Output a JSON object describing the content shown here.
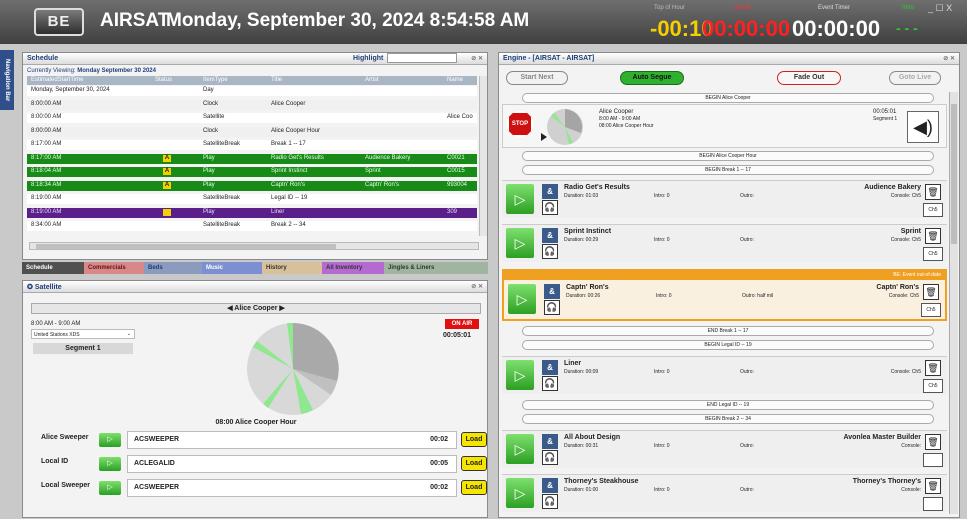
{
  "header": {
    "logo": "BE",
    "station": "AIRSAT",
    "datetime": "Monday, September 30, 2024 8:54:58 AM",
    "top_of_hour_label": "Top of Hour",
    "top_of_hour": "-00:10",
    "break_label": "Break",
    "break_value": "00:00:00",
    "event_timer_label": "Event Timer",
    "event_timer": "00:00:00",
    "intro_label": "Intro",
    "intro_value": "- - -",
    "window_controls": "_ ☐ X",
    "accent": "#f5d000",
    "break_color": "#ff2020"
  },
  "nav": {
    "label": "Navigation Bar"
  },
  "schedule": {
    "title": "Schedule",
    "highlight_label": "Highlight",
    "viewing_label": "Currently Viewing:",
    "viewing_date": "Monday September 30 2024",
    "columns": [
      "EstimatedStartTime",
      "Status",
      "ItemType",
      "Title",
      "Artist",
      "Name"
    ],
    "rows": [
      {
        "time": "Monday, September 30, 2024",
        "status": "",
        "type": "Day",
        "title": "",
        "artist": "",
        "name": "",
        "bg": "#ffffff",
        "fg": "#222",
        "badge": ""
      },
      {
        "time": "8:00:00 AM",
        "status": "",
        "type": "Clock",
        "title": "Alice Cooper",
        "artist": "",
        "name": "",
        "bg": "#f0f0f0",
        "fg": "#222",
        "badge": ""
      },
      {
        "time": "8:00:00 AM",
        "status": "",
        "type": "Satellite",
        "title": "",
        "artist": "",
        "name": "Alice Coo",
        "bg": "#ffffff",
        "fg": "#222",
        "badge": ""
      },
      {
        "time": "8:00:00 AM",
        "status": "",
        "type": "Clock",
        "title": "Alice Cooper Hour",
        "artist": "",
        "name": "",
        "bg": "#f0f0f0",
        "fg": "#222",
        "badge": ""
      },
      {
        "time": "8:17:00 AM",
        "status": "",
        "type": "SatelliteBreak",
        "title": "Break 1 -- 17",
        "artist": "",
        "name": "",
        "bg": "#ffffff",
        "fg": "#222",
        "badge": ""
      },
      {
        "time": "8:17:00 AM",
        "status": "A",
        "type": "Play",
        "title": "Radio Get's Results",
        "artist": "Audience Bakery",
        "name": "C0021",
        "bg": "#178a17",
        "fg": "#e8ffe8",
        "badge": "A"
      },
      {
        "time": "8:18:04 AM",
        "status": "A",
        "type": "Play",
        "title": "Sprint Instinct",
        "artist": "Sprint",
        "name": "C0015",
        "bg": "#178a17",
        "fg": "#e8ffe8",
        "badge": "A"
      },
      {
        "time": "8:18:34 AM",
        "status": "A",
        "type": "Play",
        "title": "Captn' Ron's",
        "artist": "Captn' Ron's",
        "name": "993004",
        "bg": "#178a17",
        "fg": "#e8ffe8",
        "badge": "A"
      },
      {
        "time": "8:19:00 AM",
        "status": "",
        "type": "SatelliteBreak",
        "title": "Legal ID -- 19",
        "artist": "",
        "name": "",
        "bg": "#ffffff",
        "fg": "#222",
        "badge": ""
      },
      {
        "time": "8:19:00 AM",
        "status": "",
        "type": "Play",
        "title": "Liner",
        "artist": "",
        "name": "309",
        "bg": "#5a1f8a",
        "fg": "#e8e0f5",
        "badge": "Y"
      },
      {
        "time": "8:34:00 AM",
        "status": "",
        "type": "SatelliteBreak",
        "title": "Break 2 -- 34",
        "artist": "",
        "name": "",
        "bg": "#ffffff",
        "fg": "#222",
        "badge": ""
      }
    ]
  },
  "tabs": [
    {
      "label": "Schedule",
      "bg": "#505050",
      "fg": "#ffffff"
    },
    {
      "label": "Commercials",
      "bg": "#d88888",
      "fg": "#6a1010"
    },
    {
      "label": "Beds",
      "bg": "#8b9bbd",
      "fg": "#1d3f7a"
    },
    {
      "label": "Music",
      "bg": "#7b8fd1",
      "fg": "#ffffff"
    },
    {
      "label": "History",
      "bg": "#d8c09a",
      "fg": "#333"
    },
    {
      "label": "All Inventory",
      "bg": "#b56ad1",
      "fg": "#333"
    },
    {
      "label": "Jingles & Liners",
      "bg": "#9fb59f",
      "fg": "#333"
    }
  ],
  "satellite": {
    "title": "Satellite",
    "now_playing": "Alice Cooper",
    "time_range": "8:00 AM - 9:00 AM",
    "station_select": "United Stations XDS",
    "segment": "Segment 1",
    "status": "ON AIR",
    "elapsed": "00:05:01",
    "hour_name": "08:00 Alice Cooper Hour",
    "slots": [
      {
        "name": "Alice Sweeper",
        "value": "ACSWEEPER",
        "time": "00:02",
        "load": "Load"
      },
      {
        "name": "Local ID",
        "value": "ACLEGALID",
        "time": "00:05",
        "load": "Load"
      },
      {
        "name": "Local Sweeper",
        "value": "ACSWEEPER",
        "time": "00:02",
        "load": "Load"
      }
    ]
  },
  "engine": {
    "title": "Engine - [AIRSAT - AIRSAT]",
    "buttons": {
      "start_next": "Start Next",
      "auto_segue": "Auto Segue",
      "fade_out": "Fade Out",
      "goto_live": "Goto Live"
    },
    "begin_label": "BEGIN Alice Cooper",
    "now": {
      "artist": "Alice Cooper",
      "range": "8:00 AM - 9:00 AM",
      "hour": "08:00 Alice Cooper Hour",
      "elapsed": "00:05:01",
      "segment": "Segment 1",
      "stop": "STOP"
    },
    "markers_top": [
      "BEGIN Alice Cooper Hour",
      "BEGIN Break 1 -- 17"
    ],
    "items": [
      {
        "title": "Radio Get's Results",
        "duration": "Duration: 01:03",
        "intro": "Intro: 0",
        "outro": "Outro:",
        "artist": "Audience Bakery",
        "console": "Console: Ch5",
        "ch": "Ch5"
      },
      {
        "title": "Sprint Instinct",
        "duration": "Duration: 00:29",
        "intro": "Intro: 0",
        "outro": "Outro:",
        "artist": "Sprint",
        "console": "Console: Ch5",
        "ch": "Ch5"
      },
      {
        "title": "Captn' Ron's",
        "duration": "Duration: 00:26",
        "intro": "Intro: 0",
        "outro": "Outro: half mil",
        "artist": "Captn' Ron's",
        "console": "Console: Ch5",
        "ch": "Ch5",
        "alert": "BE: Event out-of-date"
      },
      {
        "title": "Liner",
        "duration": "Duration: 00:09",
        "intro": "Intro: 0",
        "outro": "Outro:",
        "artist": "",
        "console": "Console: Ch5",
        "ch": "Ch5"
      },
      {
        "title": "All About Design",
        "duration": "Duration: 00:31",
        "intro": "Intro: 0",
        "outro": "Outro:",
        "artist": "Avonlea Master Builder",
        "console": "Console:",
        "ch": ""
      },
      {
        "title": "Thorney's Steakhouse",
        "duration": "Duration: 01:00",
        "intro": "Intro: 0",
        "outro": "Outro:",
        "artist": "Thorney's Thorney's",
        "console": "Console:",
        "ch": ""
      }
    ],
    "markers": [
      "END Break 1 -- 17",
      "BEGIN Legal ID -- 19",
      "END Legal ID -- 19",
      "BEGIN Break 2 -- 34"
    ]
  }
}
